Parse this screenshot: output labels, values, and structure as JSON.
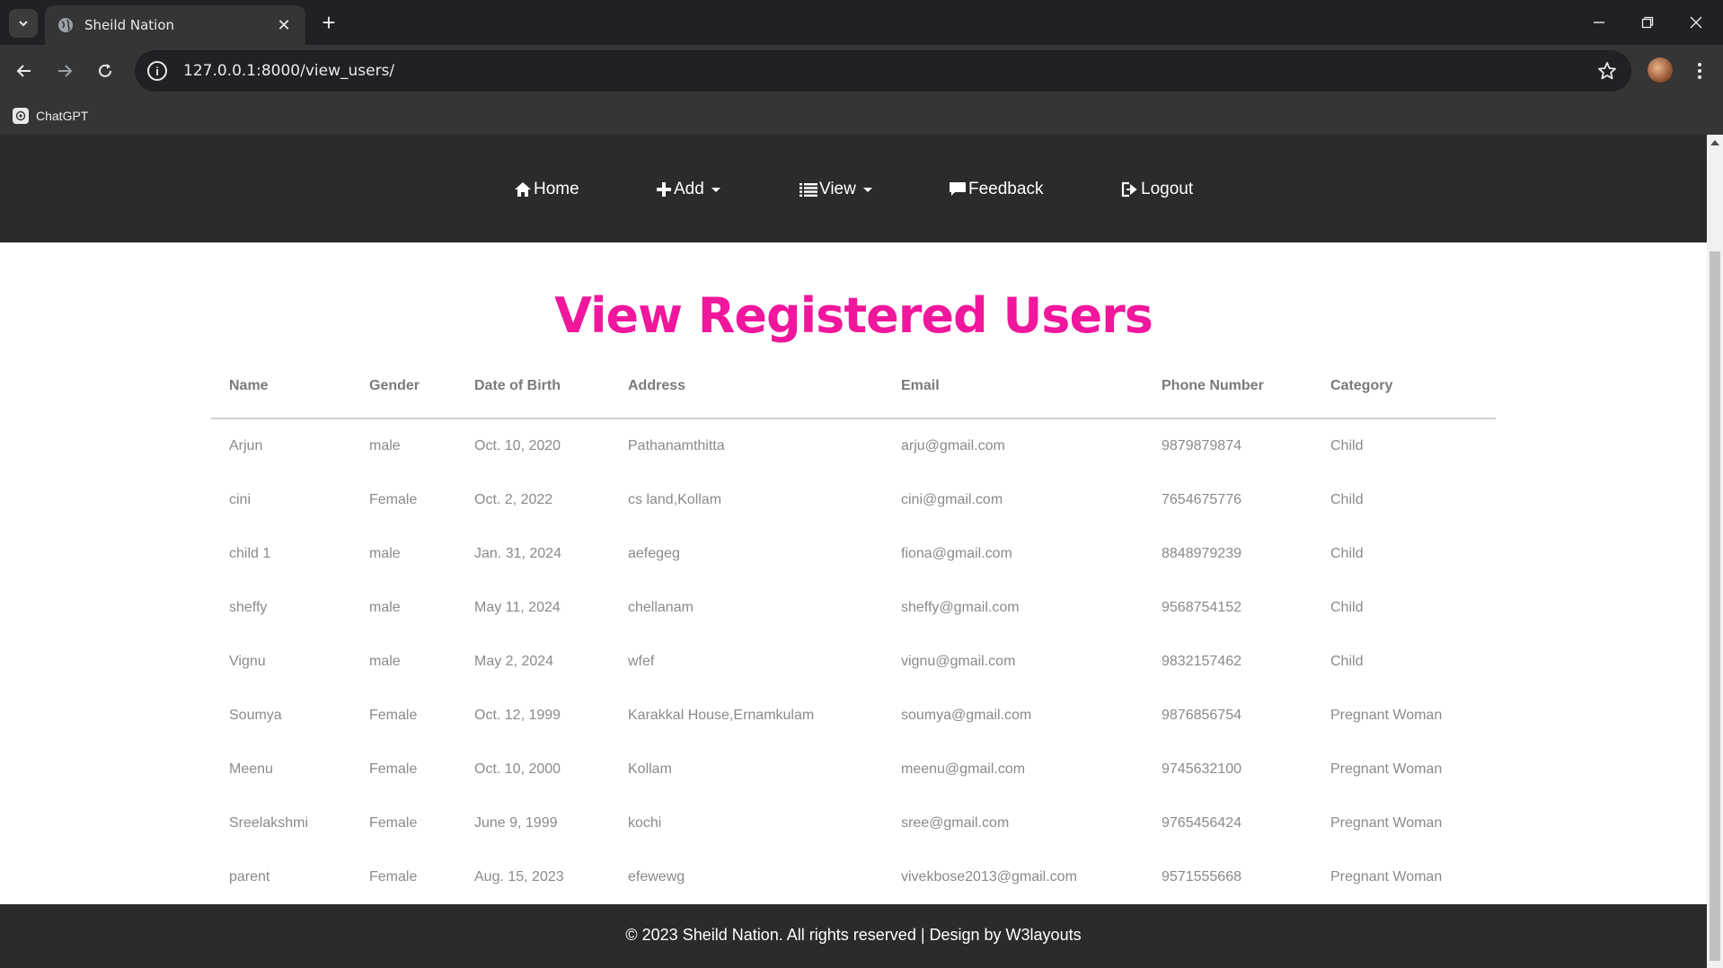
{
  "browser": {
    "tab_title": "Sheild Nation",
    "url": "127.0.0.1:8000/view_users/",
    "bookmark": "ChatGPT"
  },
  "nav": {
    "home": "Home",
    "add": "Add",
    "view": "View",
    "feedback": "Feedback",
    "logout": "Logout"
  },
  "page": {
    "title": "View Registered Users"
  },
  "table": {
    "headers": [
      "Name",
      "Gender",
      "Date of Birth",
      "Address",
      "Email",
      "Phone Number",
      "Category"
    ],
    "rows": [
      [
        "Arjun",
        "male",
        "Oct. 10, 2020",
        "Pathanamthitta",
        "arju@gmail.com",
        "9879879874",
        "Child"
      ],
      [
        "cini",
        "Female",
        "Oct. 2, 2022",
        "cs land,Kollam",
        "cini@gmail.com",
        "7654675776",
        "Child"
      ],
      [
        "child 1",
        "male",
        "Jan. 31, 2024",
        "aefegeg",
        "fiona@gmail.com",
        "8848979239",
        "Child"
      ],
      [
        "sheffy",
        "male",
        "May 11, 2024",
        "chellanam",
        "sheffy@gmail.com",
        "9568754152",
        "Child"
      ],
      [
        "Vignu",
        "male",
        "May 2, 2024",
        "wfef",
        "vignu@gmail.com",
        "9832157462",
        "Child"
      ],
      [
        "Soumya",
        "Female",
        "Oct. 12, 1999",
        "Karakkal House,Ernamkulam",
        "soumya@gmail.com",
        "9876856754",
        "Pregnant Woman"
      ],
      [
        "Meenu",
        "Female",
        "Oct. 10, 2000",
        "Kollam",
        "meenu@gmail.com",
        "9745632100",
        "Pregnant Woman"
      ],
      [
        "Sreelakshmi",
        "Female",
        "June 9, 1999",
        "kochi",
        "sree@gmail.com",
        "9765456424",
        "Pregnant Woman"
      ],
      [
        "parent",
        "Female",
        "Aug. 15, 2023",
        "efewewg",
        "vivekbose2013@gmail.com",
        "9571555668",
        "Pregnant Woman"
      ]
    ]
  },
  "footer": {
    "text": "© 2023 Sheild Nation. All rights reserved | Design by W3layouts"
  },
  "colors": {
    "title_accent": "#f0179c",
    "nav_bg": "#2b2b2b"
  }
}
